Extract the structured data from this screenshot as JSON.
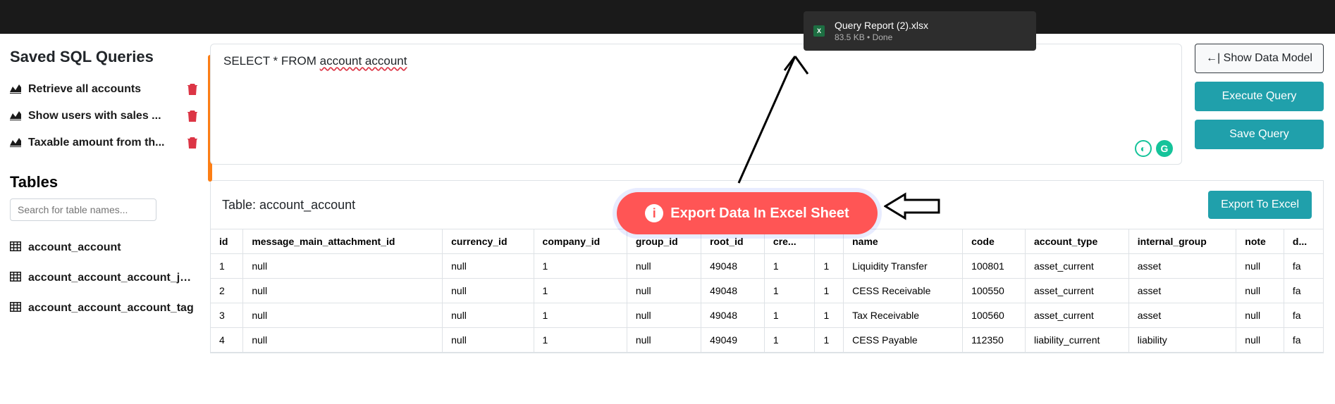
{
  "download": {
    "filename": "Query Report (2).xlsx",
    "meta": "83.5 KB • Done"
  },
  "sidebar": {
    "saved_title": "Saved SQL Queries",
    "queries": [
      {
        "label": "Retrieve all accounts"
      },
      {
        "label": "Show users with sales ..."
      },
      {
        "label": "Taxable amount from th..."
      }
    ],
    "tables_title": "Tables",
    "search_placeholder": "Search for table names...",
    "tables": [
      {
        "label": "account_account"
      },
      {
        "label": "account_account_account_journ..."
      },
      {
        "label": "account_account_account_tag"
      }
    ]
  },
  "editor": {
    "sql_prefix": "SELECT * FROM ",
    "sql_table": "account account"
  },
  "buttons": {
    "show_model": "←| Show Data Model",
    "execute": "Execute Query",
    "save": "Save Query",
    "export": "Export To Excel"
  },
  "results": {
    "table_label": "Table: account_account",
    "columns": [
      "id",
      "message_main_attachment_id",
      "currency_id",
      "company_id",
      "group_id",
      "root_id",
      "cre...",
      "",
      "name",
      "code",
      "account_type",
      "internal_group",
      "note",
      "d..."
    ],
    "rows": [
      [
        "1",
        "null",
        "null",
        "1",
        "null",
        "49048",
        "1",
        "1",
        "Liquidity Transfer",
        "100801",
        "asset_current",
        "asset",
        "null",
        "fa"
      ],
      [
        "2",
        "null",
        "null",
        "1",
        "null",
        "49048",
        "1",
        "1",
        "CESS Receivable",
        "100550",
        "asset_current",
        "asset",
        "null",
        "fa"
      ],
      [
        "3",
        "null",
        "null",
        "1",
        "null",
        "49048",
        "1",
        "1",
        "Tax Receivable",
        "100560",
        "asset_current",
        "asset",
        "null",
        "fa"
      ],
      [
        "4",
        "null",
        "null",
        "1",
        "null",
        "49049",
        "1",
        "1",
        "CESS Payable",
        "112350",
        "liability_current",
        "liability",
        "null",
        "fa"
      ]
    ]
  },
  "callout": {
    "text": "Export Data In Excel Sheet"
  }
}
